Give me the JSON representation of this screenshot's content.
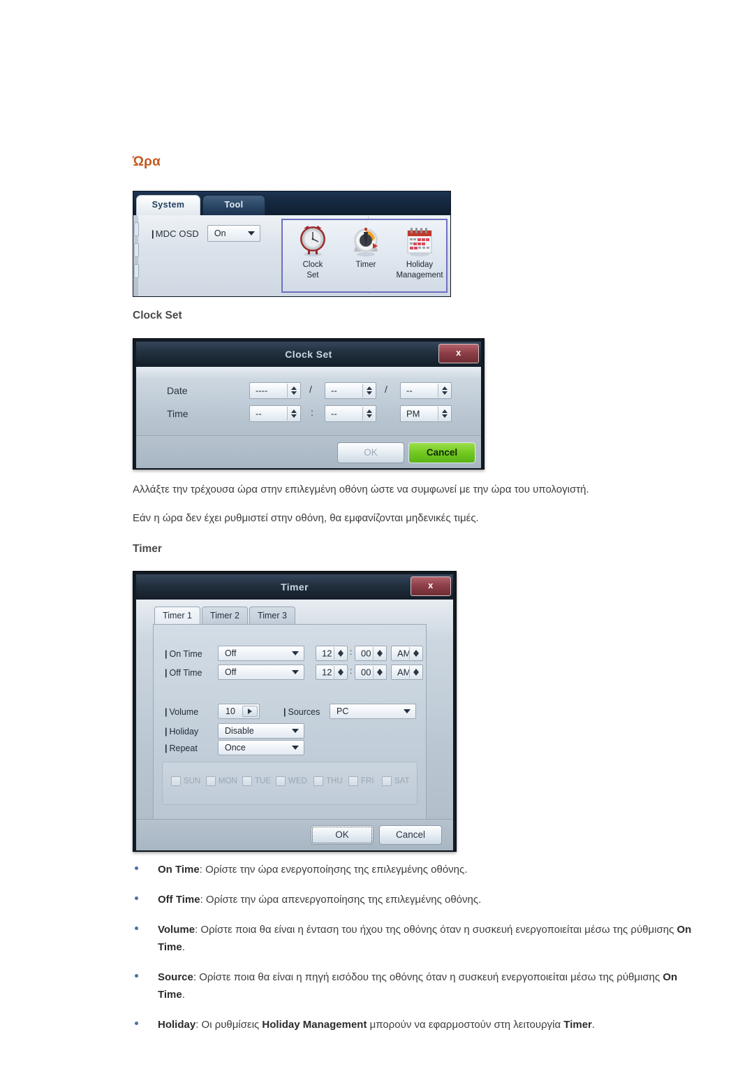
{
  "page": {
    "heading": "Ώρα",
    "section_clock_set": "Clock Set",
    "section_timer": "Timer",
    "paragraph_1": "Αλλάξτε την τρέχουσα ώρα στην επιλεγμένη οθόνη ώστε να συμφωνεί με την ώρα του υπολογιστή.",
    "paragraph_2": "Εάν η ώρα δεν έχει ρυθμιστεί στην οθόνη, θα εμφανίζονται μηδενικές τιμές."
  },
  "colors": {
    "heading": "#C2591F",
    "subheading": "#4A4A4A",
    "bullet": "#4A6FA5",
    "cancel_green": "#72C91F",
    "close_red": "#8E3F48",
    "icon_group_border": "#6F6FC0"
  },
  "ribbon": {
    "tabs": [
      {
        "label": "System",
        "active": true
      },
      {
        "label": "Tool",
        "active": false
      }
    ],
    "osd": {
      "label_bar": "|",
      "label": "MDC OSD",
      "value": "On"
    },
    "icon_group": [
      {
        "icon": "clock-icon",
        "line1": "Clock",
        "line2": "Set"
      },
      {
        "icon": "timer-gauge-icon",
        "line1": "Timer",
        "line2": ""
      },
      {
        "icon": "calendar-icon",
        "line1": "Holiday",
        "line2": "Management"
      }
    ]
  },
  "clock_set_dialog": {
    "title": "Clock Set",
    "close_label": "x",
    "rows": [
      {
        "label": "Date",
        "fields": [
          {
            "value": "----"
          },
          {
            "value": "--"
          },
          {
            "value": "--"
          }
        ],
        "separators": [
          "/",
          "/"
        ]
      },
      {
        "label": "Time",
        "fields": [
          {
            "value": "--"
          },
          {
            "value": "--"
          },
          {
            "value": "PM"
          }
        ],
        "separators": [
          ":",
          ""
        ]
      }
    ],
    "buttons": {
      "ok": "OK",
      "cancel": "Cancel"
    }
  },
  "timer_dialog": {
    "title": "Timer",
    "close_label": "x",
    "tabs": [
      {
        "label": "Timer 1",
        "active": true
      },
      {
        "label": "Timer 2",
        "active": false
      },
      {
        "label": "Timer 3",
        "active": false
      }
    ],
    "on_time": {
      "label_bar": "|",
      "label": "On Time",
      "mode": "Off",
      "hour": "12",
      "minute": "00",
      "meridiem": "AM",
      "colon": ":"
    },
    "off_time": {
      "label_bar": "|",
      "label": "Off Time",
      "mode": "Off",
      "hour": "12",
      "minute": "00",
      "meridiem": "AM",
      "colon": ":"
    },
    "volume": {
      "label_bar": "|",
      "label": "Volume",
      "value": "10"
    },
    "sources": {
      "label_bar": "|",
      "label": "Sources",
      "value": "PC"
    },
    "holiday": {
      "label_bar": "|",
      "label": "Holiday",
      "value": "Disable"
    },
    "repeat": {
      "label_bar": "|",
      "label": "Repeat",
      "value": "Once"
    },
    "days": [
      {
        "label": "SUN",
        "checked": false
      },
      {
        "label": "MON",
        "checked": false
      },
      {
        "label": "TUE",
        "checked": false
      },
      {
        "label": "WED",
        "checked": false
      },
      {
        "label": "THU",
        "checked": false
      },
      {
        "label": "FRI",
        "checked": false
      },
      {
        "label": "SAT",
        "checked": false
      }
    ],
    "buttons": {
      "ok": "OK",
      "cancel": "Cancel"
    }
  },
  "bullets": [
    {
      "term": "On Time",
      "rest": ": Ορίστε την ώρα ενεργοποίησης της επιλεγμένης οθόνης."
    },
    {
      "term": "Off Time",
      "rest": ": Ορίστε την ώρα απενεργοποίησης της επιλεγμένης οθόνης."
    },
    {
      "term": "Volume",
      "rest": ": Ορίστε ποια θα είναι η ένταση του ήχου της οθόνης όταν η συσκευή ενεργοποιείται μέσω της ρύθμισης ",
      "term2": "On Time",
      "rest2": "."
    },
    {
      "term": "Source",
      "rest": ": Ορίστε ποια θα είναι η πηγή εισόδου της οθόνης όταν η συσκευή ενεργοποιείται μέσω της ρύθμισης ",
      "term2": "On Time",
      "rest2": "."
    },
    {
      "term": "Holiday",
      "rest": ": Οι ρυθμίσεις ",
      "term2": "Holiday Management",
      "rest2": " μπορούν να εφαρμοστούν στη λειτουργία ",
      "term3": "Timer",
      "rest3": "."
    }
  ]
}
